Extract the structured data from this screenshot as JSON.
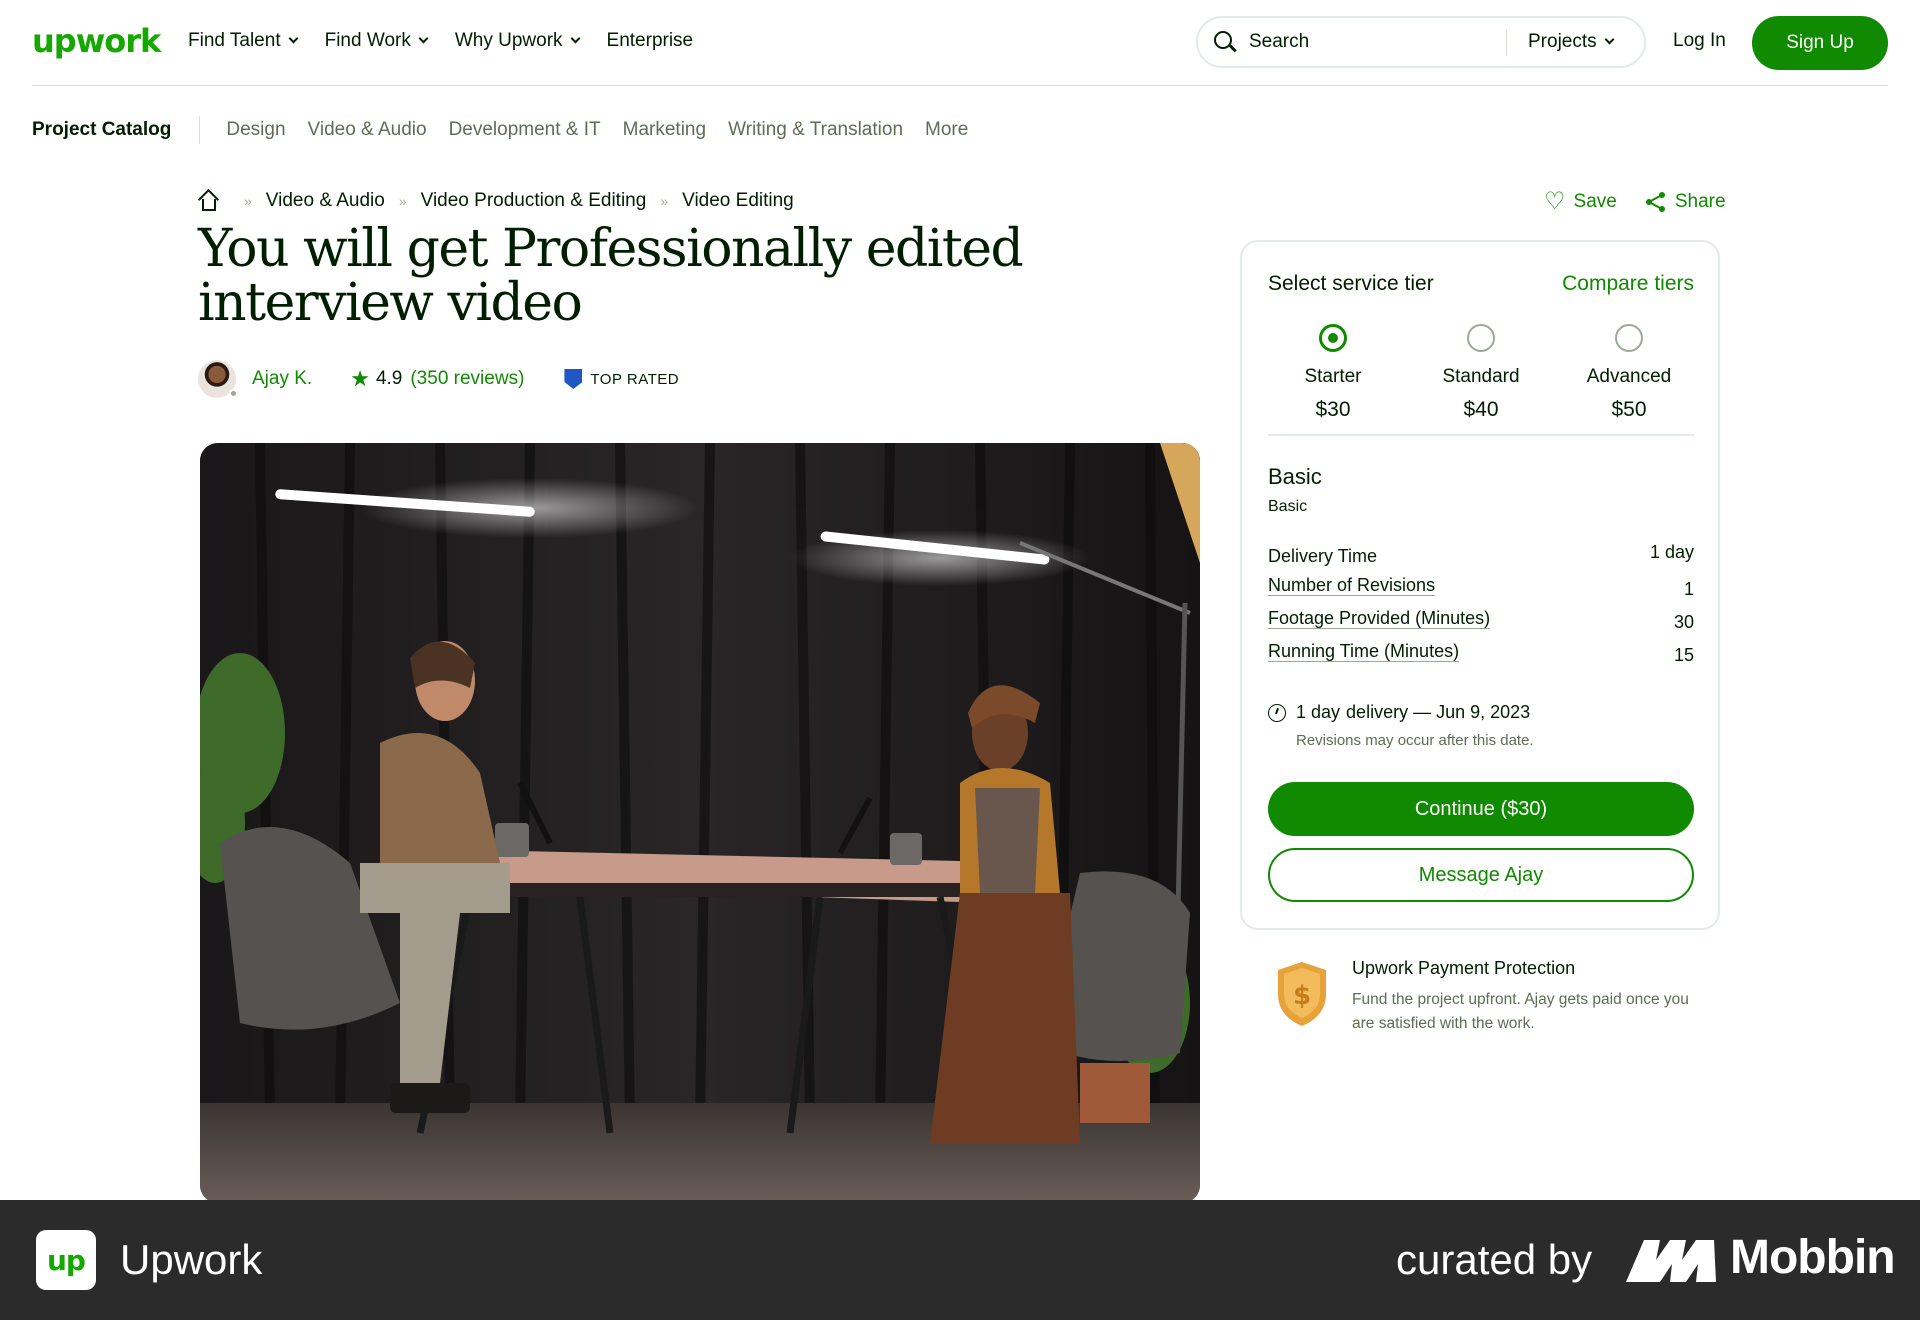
{
  "header": {
    "logo": "upwork",
    "nav": [
      {
        "label": "Find Talent",
        "dropdown": true
      },
      {
        "label": "Find Work",
        "dropdown": true
      },
      {
        "label": "Why Upwork",
        "dropdown": true
      },
      {
        "label": "Enterprise",
        "dropdown": false
      }
    ],
    "search_label": "Search",
    "search_scope": "Projects",
    "login": "Log In",
    "signup": "Sign Up"
  },
  "catalog": {
    "title": "Project Catalog",
    "links": [
      "Design",
      "Video & Audio",
      "Development & IT",
      "Marketing",
      "Writing & Translation",
      "More"
    ]
  },
  "breadcrumb": [
    "Video & Audio",
    "Video Production & Editing",
    "Video Editing"
  ],
  "actions": {
    "save": "Save",
    "share": "Share"
  },
  "project": {
    "title": "You will get Professionally edited interview video",
    "seller_name": "Ajay K.",
    "rating": "4.9",
    "reviews": "(350 reviews)",
    "badge": "TOP RATED"
  },
  "tier_card": {
    "title": "Select service tier",
    "compare": "Compare tiers",
    "tiers": [
      {
        "name": "Starter",
        "price": "$30",
        "selected": true
      },
      {
        "name": "Standard",
        "price": "$40",
        "selected": false
      },
      {
        "name": "Advanced",
        "price": "$50",
        "selected": false
      }
    ],
    "package_title": "Basic",
    "package_subtitle": "Basic",
    "specs": [
      {
        "label": "Delivery Time",
        "value": "1 day"
      },
      {
        "label": "Number of Revisions",
        "value": "1"
      },
      {
        "label": "Footage Provided (Minutes)",
        "value": "30"
      },
      {
        "label": "Running Time (Minutes)",
        "value": "15"
      }
    ],
    "delivery_strong": "1 day",
    "delivery_rest": "delivery — Jun 9, 2023",
    "delivery_note": "Revisions may occur after this date.",
    "continue": "Continue ($30)",
    "message": "Message Ajay"
  },
  "protection": {
    "title": "Upwork Payment Protection",
    "text": "Fund the project upfront. Ajay gets paid once you are satisfied with the work."
  },
  "footer": {
    "app_icon": "up",
    "app_name": "Upwork",
    "curated": "curated by",
    "brand": "Mobbin"
  },
  "colors": {
    "brand_green": "#108a00",
    "logo_green": "#14a800",
    "footer_bg": "#2b2b2b"
  }
}
